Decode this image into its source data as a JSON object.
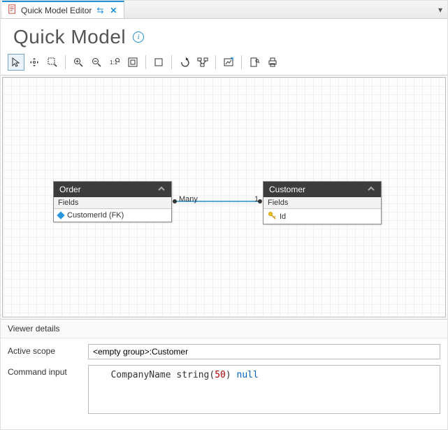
{
  "tab": {
    "title": "Quick Model Editor",
    "pin_glyph": "⇆",
    "close_glyph": "✕",
    "dropdown_glyph": "▾"
  },
  "header": {
    "title": "Quick Model",
    "info_glyph": "i"
  },
  "toolbar": {
    "select": "Select",
    "pan": "Pan",
    "marquee": "Marquee Zoom",
    "zoom_in": "Zoom In",
    "zoom_out": "Zoom Out",
    "zoom_100": "100%",
    "fit": "Fit to Window",
    "overview": "Full Page",
    "undo": "Undo",
    "layout": "Auto Layout",
    "export_image": "Export Image",
    "export": "Export",
    "print": "Print"
  },
  "entities": {
    "order": {
      "title": "Order",
      "section": "Fields",
      "field1": "CustomerId (FK)"
    },
    "customer": {
      "title": "Customer",
      "section": "Fields",
      "field1": "Id"
    }
  },
  "relation": {
    "left_label": "Many",
    "right_label": "1"
  },
  "details": {
    "header": "Viewer details",
    "active_scope_label": "Active scope",
    "active_scope_value": "<empty group>:Customer",
    "command_input_label": "Command input",
    "cmd_name": "CompanyName",
    "cmd_type": "string",
    "cmd_open": "(",
    "cmd_len": "50",
    "cmd_close": ")",
    "cmd_null": "null"
  }
}
